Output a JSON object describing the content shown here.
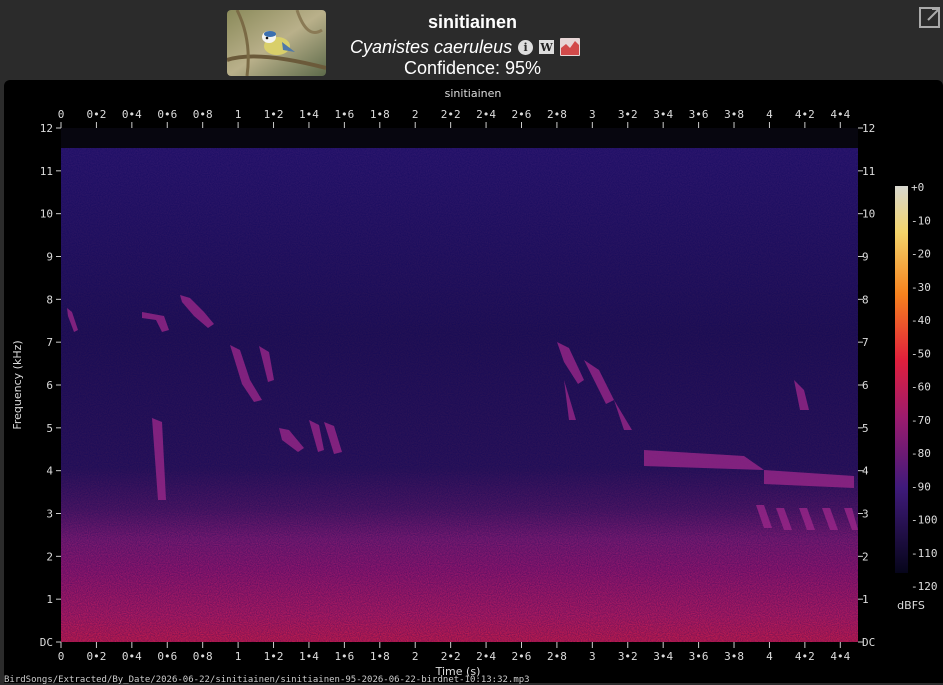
{
  "header": {
    "common_name": "sinitiainen",
    "scientific_name": "Cyanistes caeruleus",
    "confidence": "Confidence: 95%",
    "info_icon": "info-icon",
    "wiki_icon": "wikipedia-icon",
    "chart_icon": "area-chart-icon",
    "expand_icon": "expand-icon",
    "wiki_glyph": "W",
    "info_glyph": "i"
  },
  "spectrogram": {
    "title": "sinitiainen",
    "xlabel": "Time (s)",
    "ylabel": "Frequency (kHz)",
    "x_ticks": [
      "0",
      "0•2",
      "0•4",
      "0•6",
      "0•8",
      "1",
      "1•2",
      "1•4",
      "1•6",
      "1•8",
      "2",
      "2•2",
      "2•4",
      "2•6",
      "2•8",
      "3",
      "3•2",
      "3•4",
      "3•6",
      "3•8",
      "4",
      "4•2",
      "4•4"
    ],
    "y_ticks": [
      "DC",
      "1",
      "2",
      "3",
      "4",
      "5",
      "6",
      "7",
      "8",
      "9",
      "10",
      "11",
      "12"
    ],
    "colorbar_ticks": [
      "+0",
      "-10",
      "-20",
      "-30",
      "-40",
      "-50",
      "-60",
      "-70",
      "-80",
      "-90",
      "-100",
      "-110",
      "-120"
    ],
    "colorbar_label": "dBFS",
    "colorbar_range": [
      -120,
      0
    ],
    "time_range_s": [
      0,
      4.5
    ],
    "freq_range_khz": [
      0,
      12
    ]
  },
  "footer": {
    "file_path": "BirdSongs/Extracted/By_Date/2026-06-22/sinitiainen/sinitiainen-95-2026-06-22-birdnet-10:13:32.mp3"
  }
}
